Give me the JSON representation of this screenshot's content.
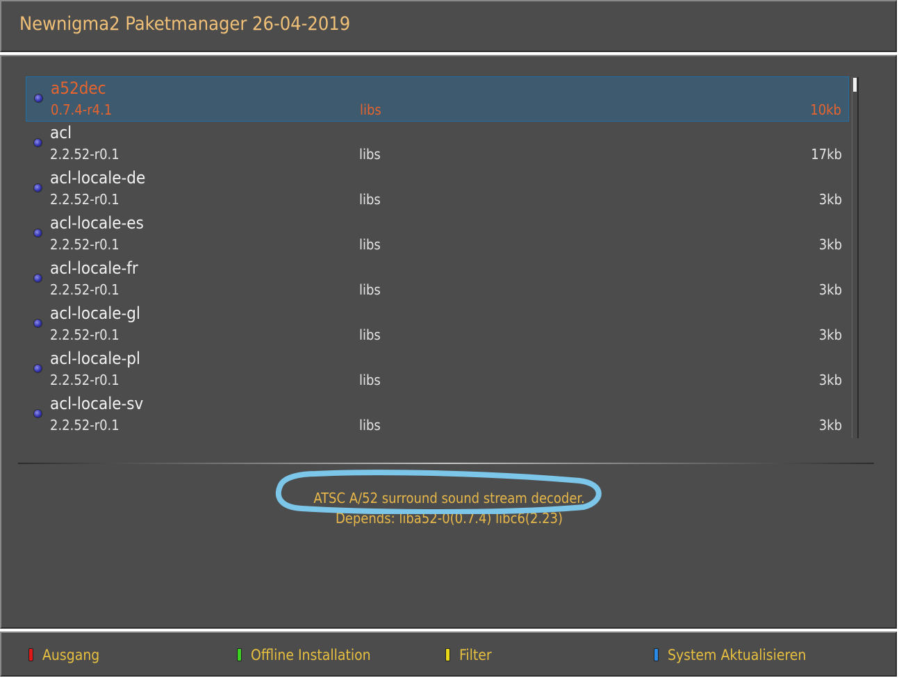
{
  "window": {
    "title": "Newnigma2 Paketmanager 26-04-2019"
  },
  "packages": [
    {
      "name": "a52dec",
      "version": "0.7.4-r4.1",
      "section": "libs",
      "size": "10kb",
      "selected": true
    },
    {
      "name": "acl",
      "version": "2.2.52-r0.1",
      "section": "libs",
      "size": "17kb",
      "selected": false
    },
    {
      "name": "acl-locale-de",
      "version": "2.2.52-r0.1",
      "section": "libs",
      "size": "3kb",
      "selected": false
    },
    {
      "name": "acl-locale-es",
      "version": "2.2.52-r0.1",
      "section": "libs",
      "size": "3kb",
      "selected": false
    },
    {
      "name": "acl-locale-fr",
      "version": "2.2.52-r0.1",
      "section": "libs",
      "size": "3kb",
      "selected": false
    },
    {
      "name": "acl-locale-gl",
      "version": "2.2.52-r0.1",
      "section": "libs",
      "size": "3kb",
      "selected": false
    },
    {
      "name": "acl-locale-pl",
      "version": "2.2.52-r0.1",
      "section": "libs",
      "size": "3kb",
      "selected": false
    },
    {
      "name": "acl-locale-sv",
      "version": "2.2.52-r0.1",
      "section": "libs",
      "size": "3kb",
      "selected": false
    }
  ],
  "description": {
    "line1": "ATSC A/52 surround sound stream decoder.",
    "line2": "Depends: liba52-0(0.7.4) libc6(2.23)"
  },
  "buttons": {
    "red": {
      "label": "Ausgang",
      "color": "#e01818"
    },
    "green": {
      "label": "Offline Installation",
      "color": "#3cd020"
    },
    "yellow": {
      "label": "Filter",
      "color": "#e8d818"
    },
    "blue": {
      "label": "System Aktualisieren",
      "color": "#2a8ae8"
    }
  },
  "colors": {
    "panel_background": "#4c4c4c",
    "title_text": "#f0c078",
    "selected_row_text": "#e8642e",
    "selected_row_background": "#3d5a6e",
    "description_text": "#e8b84a",
    "annotation_outline": "#7cc6ea"
  },
  "icons": {
    "row_bullet": "package-status-bullet-icon"
  }
}
